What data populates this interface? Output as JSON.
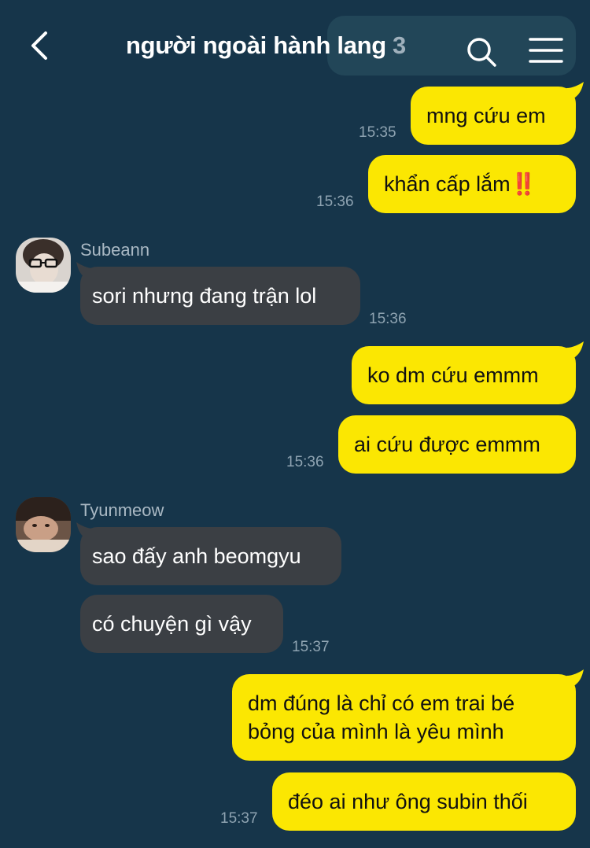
{
  "header": {
    "title": "người ngoài hành lang",
    "member_count": "3",
    "back_icon": "chevron-left-icon",
    "search_icon": "search-icon",
    "menu_icon": "hamburger-menu-icon"
  },
  "colors": {
    "background": "#16354a",
    "my_bubble": "#fbe702",
    "their_bubble": "#3b3f44",
    "timestamp": "#8ea3b1"
  },
  "messages": [
    {
      "sender": "me",
      "text": "mng cứu em",
      "time": "15:35"
    },
    {
      "sender": "me",
      "text": "khẩn cấp lắm",
      "emoji": "‼️",
      "time": "15:36"
    },
    {
      "sender": "Subeann",
      "text": "sori nhưng đang trận lol",
      "time": "15:36"
    },
    {
      "sender": "me",
      "text": "ko dm cứu emmm",
      "time": ""
    },
    {
      "sender": "me",
      "text": "ai cứu được emmm",
      "time": "15:36"
    },
    {
      "sender": "Tyunmeow",
      "text": "sao đấy anh beomgyu",
      "time": ""
    },
    {
      "sender": "Tyunmeow",
      "text": "có chuyện gì vậy",
      "time": "15:37"
    },
    {
      "sender": "me",
      "text_line1": "dm đúng là chỉ có em trai bé",
      "text_line2": "bỏng của mình là yêu mình",
      "time": ""
    },
    {
      "sender": "me",
      "text": "đéo ai như ông subin thối",
      "time": "15:37"
    }
  ]
}
